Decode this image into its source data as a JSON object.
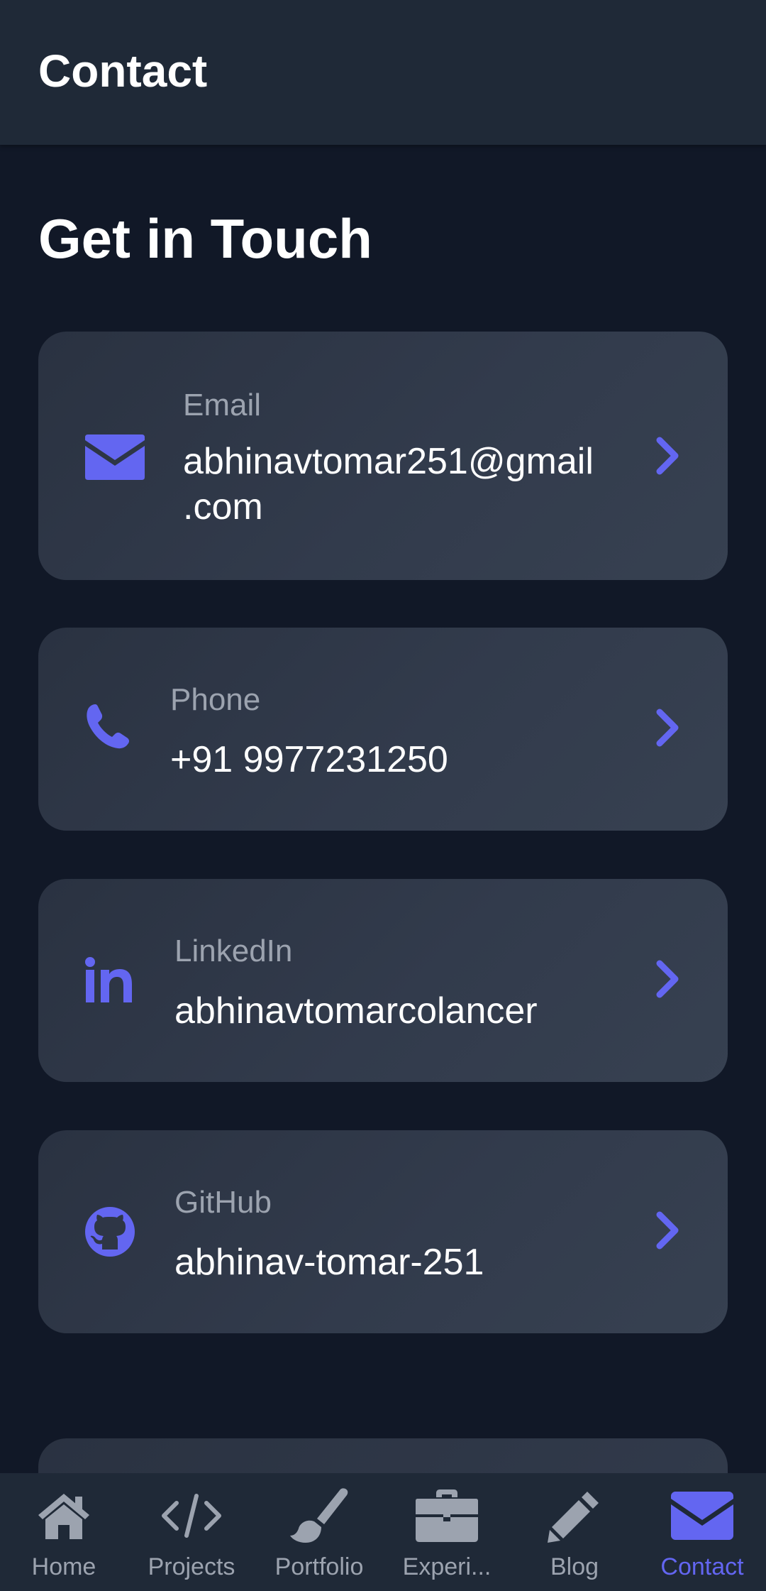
{
  "header": {
    "title": "Contact"
  },
  "main": {
    "section_title": "Get in Touch",
    "contacts": [
      {
        "icon": "envelope-icon",
        "label": "Email",
        "value_line1": "abhinavtomar251@gmail",
        "value_line2": ".com"
      },
      {
        "icon": "phone-icon",
        "label": "Phone",
        "value": "+91 9977231250"
      },
      {
        "icon": "linkedin-icon",
        "label": "LinkedIn",
        "value": "abhinavtomarcolancer"
      },
      {
        "icon": "github-icon",
        "label": "GitHub",
        "value": "abhinav-tomar-251"
      }
    ]
  },
  "bottom_nav": {
    "items": [
      {
        "label": "Home",
        "icon": "home-icon"
      },
      {
        "label": "Projects",
        "icon": "code-icon"
      },
      {
        "label": "Portfolio",
        "icon": "paintbrush-icon"
      },
      {
        "label": "Experi...",
        "icon": "briefcase-icon"
      },
      {
        "label": "Blog",
        "icon": "pencil-icon"
      },
      {
        "label": "Contact",
        "icon": "envelope-icon",
        "active": true
      }
    ]
  },
  "colors": {
    "accent": "#6366f1",
    "background": "#111827",
    "header": "#1f2937",
    "card": "#323b4c",
    "muted_text": "#9ca3af"
  }
}
